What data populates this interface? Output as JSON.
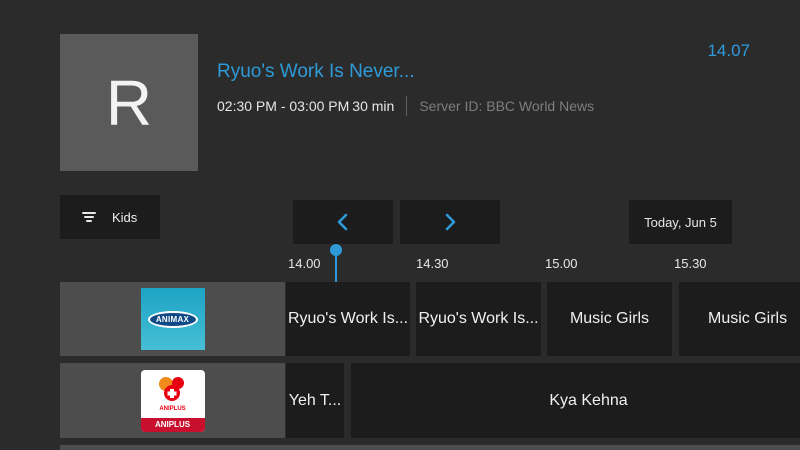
{
  "program": {
    "thumbnail_letter": "R",
    "title": "Ryuo's Work Is Never...",
    "time_range": "02:30 PM - 03:00 PM",
    "duration": "30 min",
    "server": "Server ID: BBC World News"
  },
  "clock": "14.07",
  "filter": {
    "label": "Kids"
  },
  "date": {
    "label": "Today, Jun 5"
  },
  "timeline": {
    "ticks": [
      "14.00",
      "14.30",
      "15.00",
      "15.30"
    ]
  },
  "channels": [
    {
      "logo_text": "ANIMAX",
      "programs": [
        "Ryuo's Work Is...",
        "Ryuo's Work Is...",
        "Music Girls",
        "Music Girls"
      ]
    },
    {
      "logo_text": "ANIPLUS",
      "logo_small_text": "ANIPLUS",
      "programs": [
        "Yeh T...",
        "Kya Kehna"
      ]
    }
  ],
  "colors": {
    "accent": "#2e9bd9",
    "background": "#2b2b2b",
    "tile": "#1c1c1c",
    "channel_cell": "#4d4d4d"
  }
}
